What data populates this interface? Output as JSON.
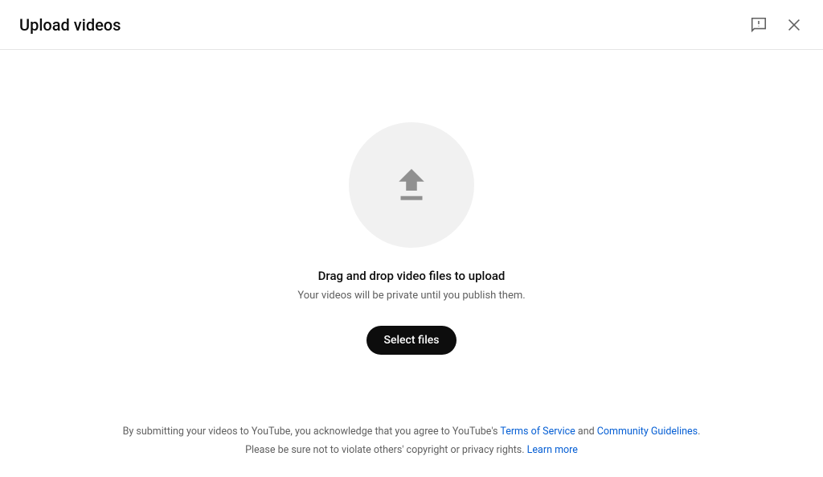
{
  "header": {
    "title": "Upload videos"
  },
  "main": {
    "drag_text": "Drag and drop video files to upload",
    "sub_text": "Your videos will be private until you publish them.",
    "select_label": "Select files"
  },
  "legal": {
    "prefix1": "By submitting your videos to YouTube, you acknowledge that you agree to YouTube's ",
    "tos_label": "Terms of Service",
    "and": " and ",
    "cg_label": "Community Guidelines",
    "period": ".",
    "line2_prefix": "Please be sure not to violate others' copyright or privacy rights. ",
    "learn_more": "Learn more"
  }
}
